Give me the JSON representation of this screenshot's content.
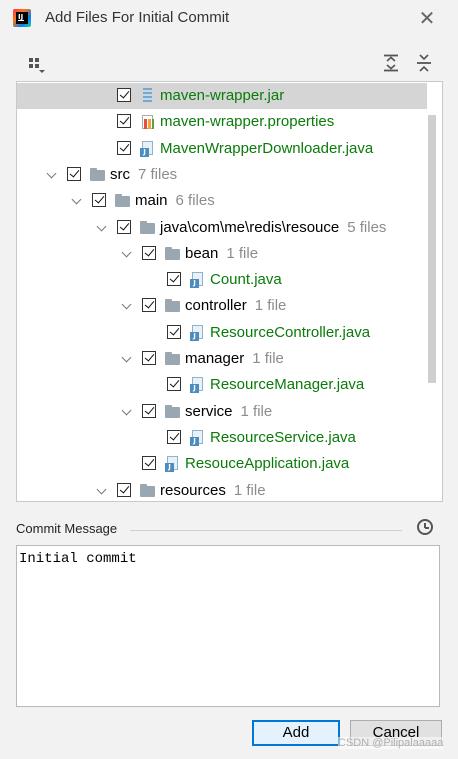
{
  "window": {
    "title": "Add Files For Initial Commit",
    "close_glyph": "✕"
  },
  "tree": [
    {
      "indent": 3,
      "chevron": false,
      "icon": "jar-icon",
      "label": "maven-wrapper.jar",
      "count": "",
      "green": true,
      "selected": true
    },
    {
      "indent": 3,
      "chevron": false,
      "icon": "properties-icon",
      "label": "maven-wrapper.properties",
      "count": "",
      "green": true
    },
    {
      "indent": 3,
      "chevron": false,
      "icon": "java-icon",
      "label": "MavenWrapperDownloader.java",
      "count": "",
      "green": true
    },
    {
      "indent": 1,
      "chevron": true,
      "icon": "folder-icon",
      "label": "src",
      "count": "7 files",
      "green": false
    },
    {
      "indent": 2,
      "chevron": true,
      "icon": "folder-icon",
      "label": "main",
      "count": "6 files",
      "green": false
    },
    {
      "indent": 3,
      "chevron": true,
      "icon": "folder-icon",
      "label": "java\\com\\me\\redis\\resouce",
      "count": "5 files",
      "green": false
    },
    {
      "indent": 4,
      "chevron": true,
      "icon": "folder-icon",
      "label": "bean",
      "count": "1 file",
      "green": false
    },
    {
      "indent": 5,
      "chevron": false,
      "icon": "java-icon",
      "label": "Count.java",
      "count": "",
      "green": true
    },
    {
      "indent": 4,
      "chevron": true,
      "icon": "folder-icon",
      "label": "controller",
      "count": "1 file",
      "green": false
    },
    {
      "indent": 5,
      "chevron": false,
      "icon": "java-icon",
      "label": "ResourceController.java",
      "count": "",
      "green": true
    },
    {
      "indent": 4,
      "chevron": true,
      "icon": "folder-icon",
      "label": "manager",
      "count": "1 file",
      "green": false
    },
    {
      "indent": 5,
      "chevron": false,
      "icon": "java-icon",
      "label": "ResourceManager.java",
      "count": "",
      "green": true
    },
    {
      "indent": 4,
      "chevron": true,
      "icon": "folder-icon",
      "label": "service",
      "count": "1 file",
      "green": false
    },
    {
      "indent": 5,
      "chevron": false,
      "icon": "java-icon",
      "label": "ResourceService.java",
      "count": "",
      "green": true
    },
    {
      "indent": 4,
      "chevron": false,
      "icon": "java-icon",
      "label": "ResouceApplication.java",
      "count": "",
      "green": true
    },
    {
      "indent": 3,
      "chevron": true,
      "icon": "folder-icon",
      "label": "resources",
      "count": "1 file",
      "green": false
    }
  ],
  "commit": {
    "label": "Commit Message",
    "message": "Initial commit"
  },
  "buttons": {
    "add": "Add",
    "cancel": "Cancel"
  },
  "watermark": "CSDN @Pilipalaaaaa",
  "colors": {
    "added_file": "#0a7b0a",
    "count_text": "#8c8c8c",
    "selected_row": "#d5d5d5",
    "default_button_border": "#0078d7"
  }
}
